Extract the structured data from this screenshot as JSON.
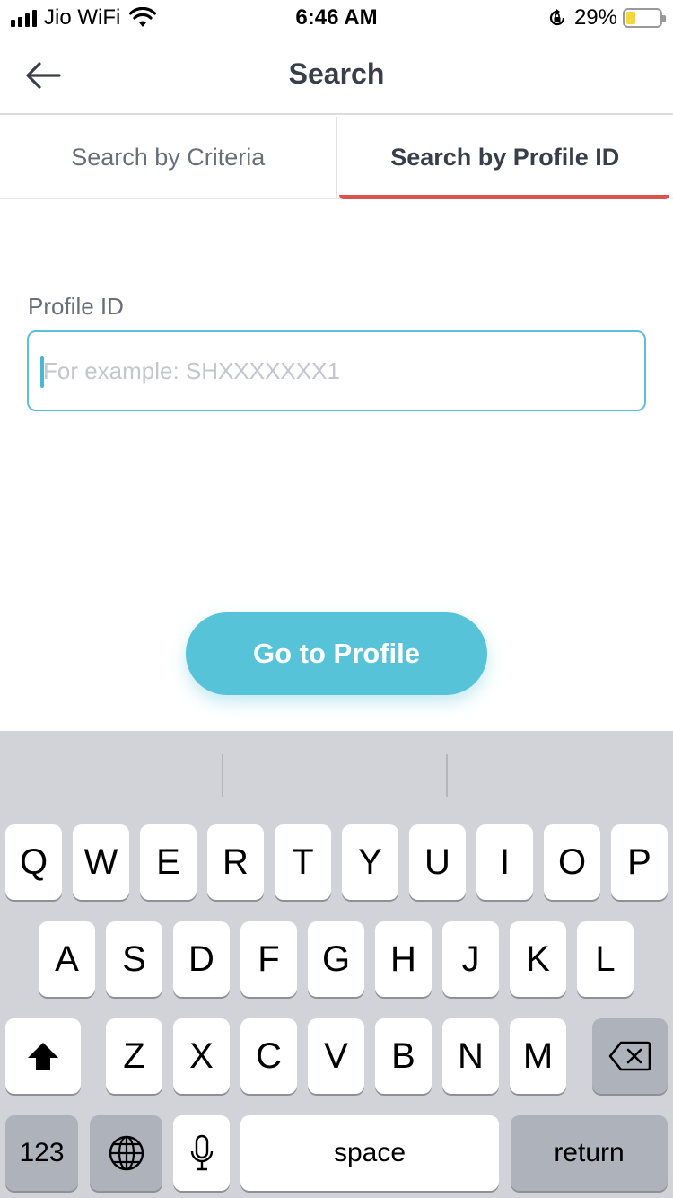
{
  "status_bar": {
    "carrier": "Jio WiFi",
    "time": "6:46 AM",
    "battery_percent": "29%",
    "battery_level": 0.29,
    "icons": [
      "signal-icon",
      "wifi-icon",
      "orientation-lock-icon",
      "battery-icon"
    ]
  },
  "header": {
    "title": "Search",
    "back_icon": "back-arrow-icon"
  },
  "tabs": [
    {
      "label": "Search by Criteria",
      "active": false
    },
    {
      "label": "Search by Profile ID",
      "active": true
    }
  ],
  "form": {
    "label": "Profile ID",
    "placeholder": "For example: SHXXXXXXX1",
    "value": "",
    "button_label": "Go to Profile"
  },
  "colors": {
    "accent": "#56c3d9",
    "tab_indicator": "#d9534f",
    "text": "#3a3d4a"
  },
  "keyboard": {
    "row1": [
      "Q",
      "W",
      "E",
      "R",
      "T",
      "Y",
      "U",
      "I",
      "O",
      "P"
    ],
    "row2": [
      "A",
      "S",
      "D",
      "F",
      "G",
      "H",
      "J",
      "K",
      "L"
    ],
    "row3": [
      "Z",
      "X",
      "C",
      "V",
      "B",
      "N",
      "M"
    ],
    "numbers_label": "123",
    "space_label": "space",
    "return_label": "return",
    "shift_icon": "shift-icon",
    "delete_icon": "delete-icon",
    "globe_icon": "globe-icon",
    "mic_icon": "microphone-icon"
  }
}
